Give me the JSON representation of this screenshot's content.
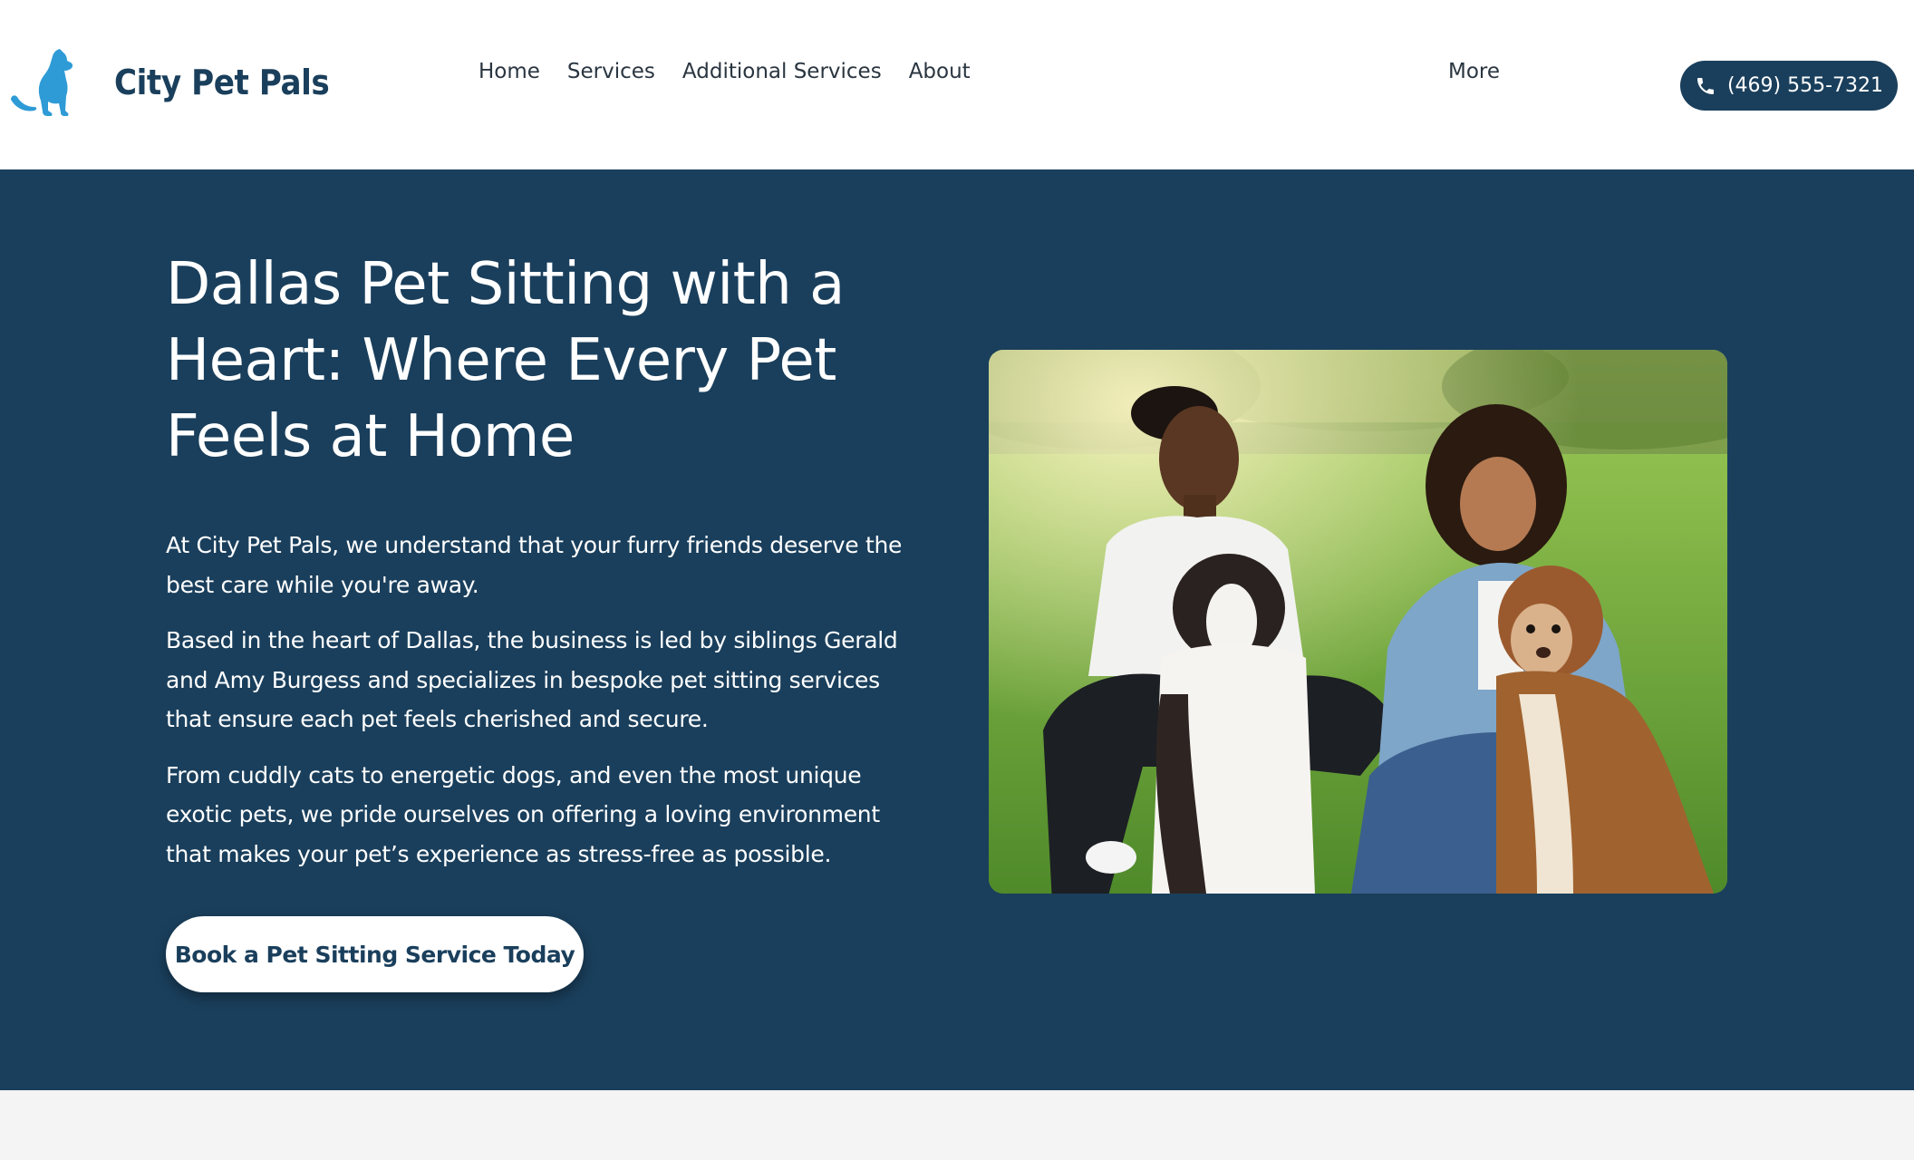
{
  "brand": {
    "name": "City Pet Pals",
    "logo_icon": "dog-cat-logo-icon",
    "logo_color": "#2e9bd6",
    "text_color": "#1a3f5c"
  },
  "nav": {
    "items": [
      {
        "label": "Home"
      },
      {
        "label": "Services"
      },
      {
        "label": "Additional Services"
      },
      {
        "label": "About"
      }
    ],
    "more_label": "More"
  },
  "phone": {
    "icon": "phone-icon",
    "label": "(469) 555-7321"
  },
  "hero": {
    "background": "#1a3f5c",
    "title": "Dallas Pet Sitting with a Heart: Where Every Pet Feels at Home",
    "paragraphs": [
      "At City Pet Pals, we understand that your furry friends deserve the best care while you're away.",
      "Based in the heart of Dallas, the business is led by siblings Gerald and Amy Burgess and specializes in bespoke pet sitting services that ensure each pet feels cherished and secure.",
      "From cuddly cats to energetic dogs, and even the most unique exotic pets, we pride ourselves on offering a loving environment that makes your pet’s experience as stress-free as possible."
    ],
    "cta_label": "Book a Pet Sitting Service Today",
    "photo_icon": "owners-with-dogs-photo"
  }
}
